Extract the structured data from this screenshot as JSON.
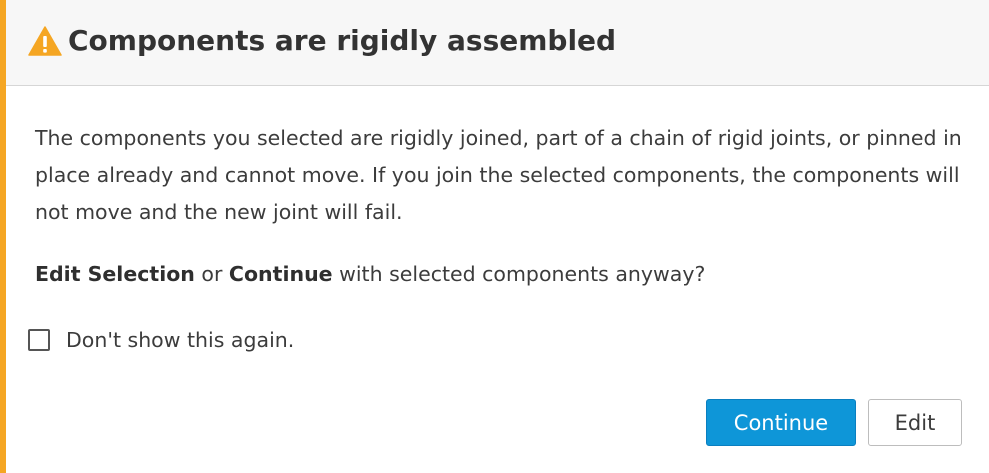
{
  "dialog": {
    "title": "Components are rigidly assembled",
    "message": "The components you selected are rigidly joined, part of a chain of rigid joints, or pinned in place already and cannot move. If you join the selected components, the components will not move and the new joint will fail.",
    "question": {
      "edit_selection": "Edit Selection",
      "or": " or ",
      "continue": "Continue",
      "rest": " with selected components anyway?"
    },
    "dont_show_label": "Don't show this again.",
    "dont_show_checked": false,
    "buttons": {
      "continue_label": "Continue",
      "edit_label": "Edit"
    },
    "icon": "warning-triangle-icon"
  },
  "colors": {
    "accent": "#f5a623",
    "warning_icon": "#f5a623",
    "primary_button": "#0e96d8",
    "header_bg": "#f7f7f7"
  }
}
